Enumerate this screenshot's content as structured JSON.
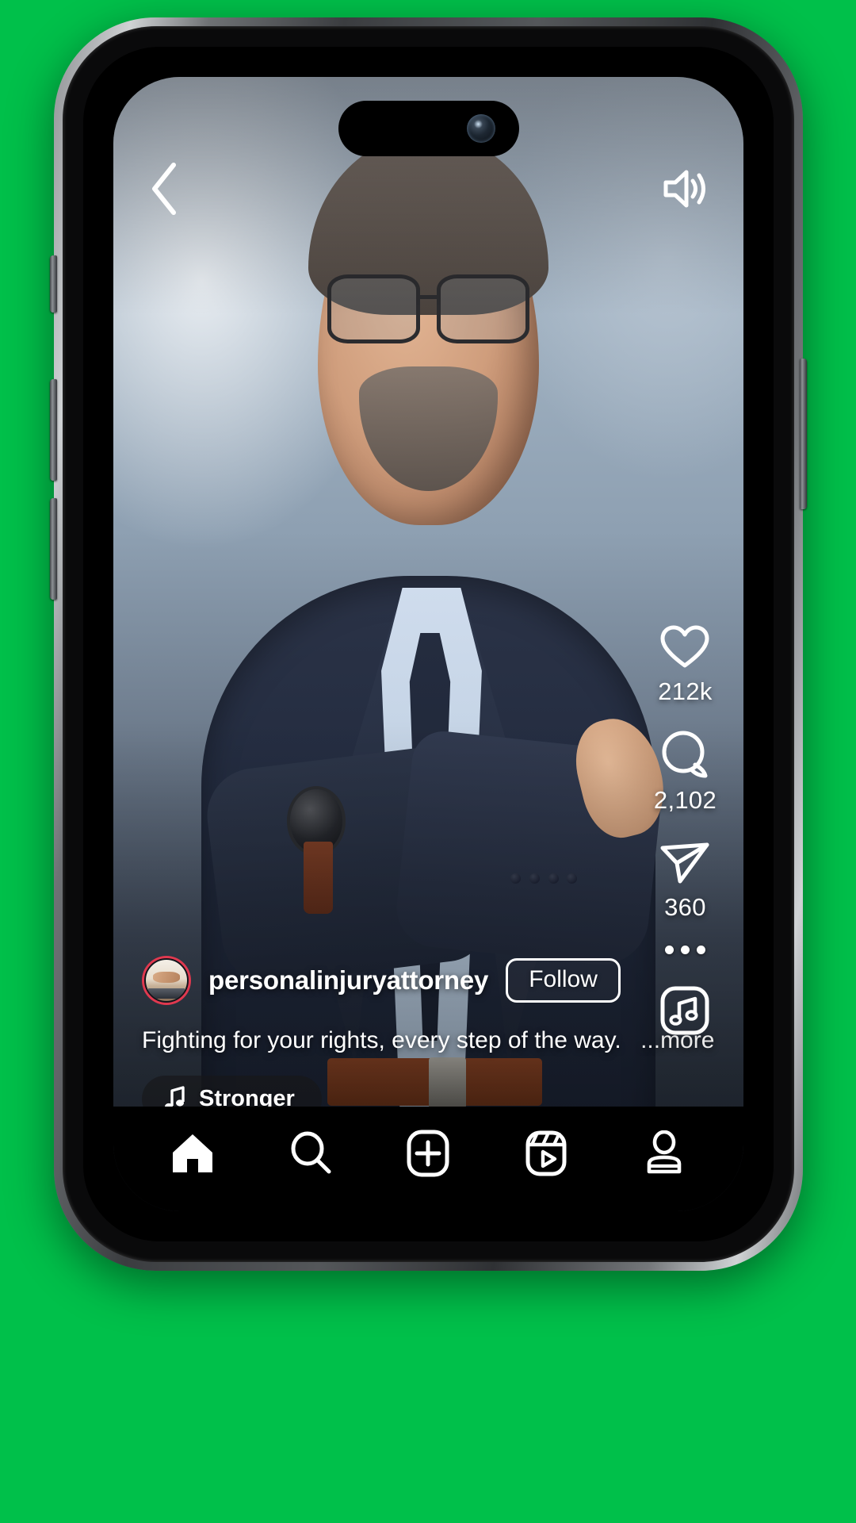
{
  "app": {
    "screen_name": "reels-video-player",
    "device": "smartphone-mockup"
  },
  "colors": {
    "accent_ring": "#E0394F",
    "overlay_text": "#FFFFFF",
    "nav_background": "#000000",
    "pill_background": "rgba(22,22,24,0.62)"
  },
  "topbar": {
    "back_icon": "chevron-left-icon",
    "sound_icon": "speaker-on-icon"
  },
  "actions": [
    {
      "icon": "heart-icon",
      "name": "like",
      "count": "212k"
    },
    {
      "icon": "comment-icon",
      "name": "comment",
      "count": "2,102"
    },
    {
      "icon": "share-icon",
      "name": "share",
      "count": "360"
    }
  ],
  "more": {
    "icon": "more-dots-icon",
    "label": "More options"
  },
  "album": {
    "icon": "music-note-square-icon",
    "label": "Audio page"
  },
  "post": {
    "username": "personalinjuryattorney",
    "avatar_icon": "user-avatar",
    "follow_label": "Follow",
    "caption": "Fighting for your rights, every step of the way.",
    "more_label": "...more",
    "music_icon": "music-note-icon",
    "music_title": "Stronger"
  },
  "nav": {
    "items": [
      {
        "icon": "home-icon",
        "label": "Home",
        "active": true
      },
      {
        "icon": "search-icon",
        "label": "Search",
        "active": false
      },
      {
        "icon": "create-icon",
        "label": "Create",
        "active": false
      },
      {
        "icon": "reels-icon",
        "label": "Reels",
        "active": false
      },
      {
        "icon": "profile-icon",
        "label": "Profile",
        "active": false
      }
    ]
  }
}
